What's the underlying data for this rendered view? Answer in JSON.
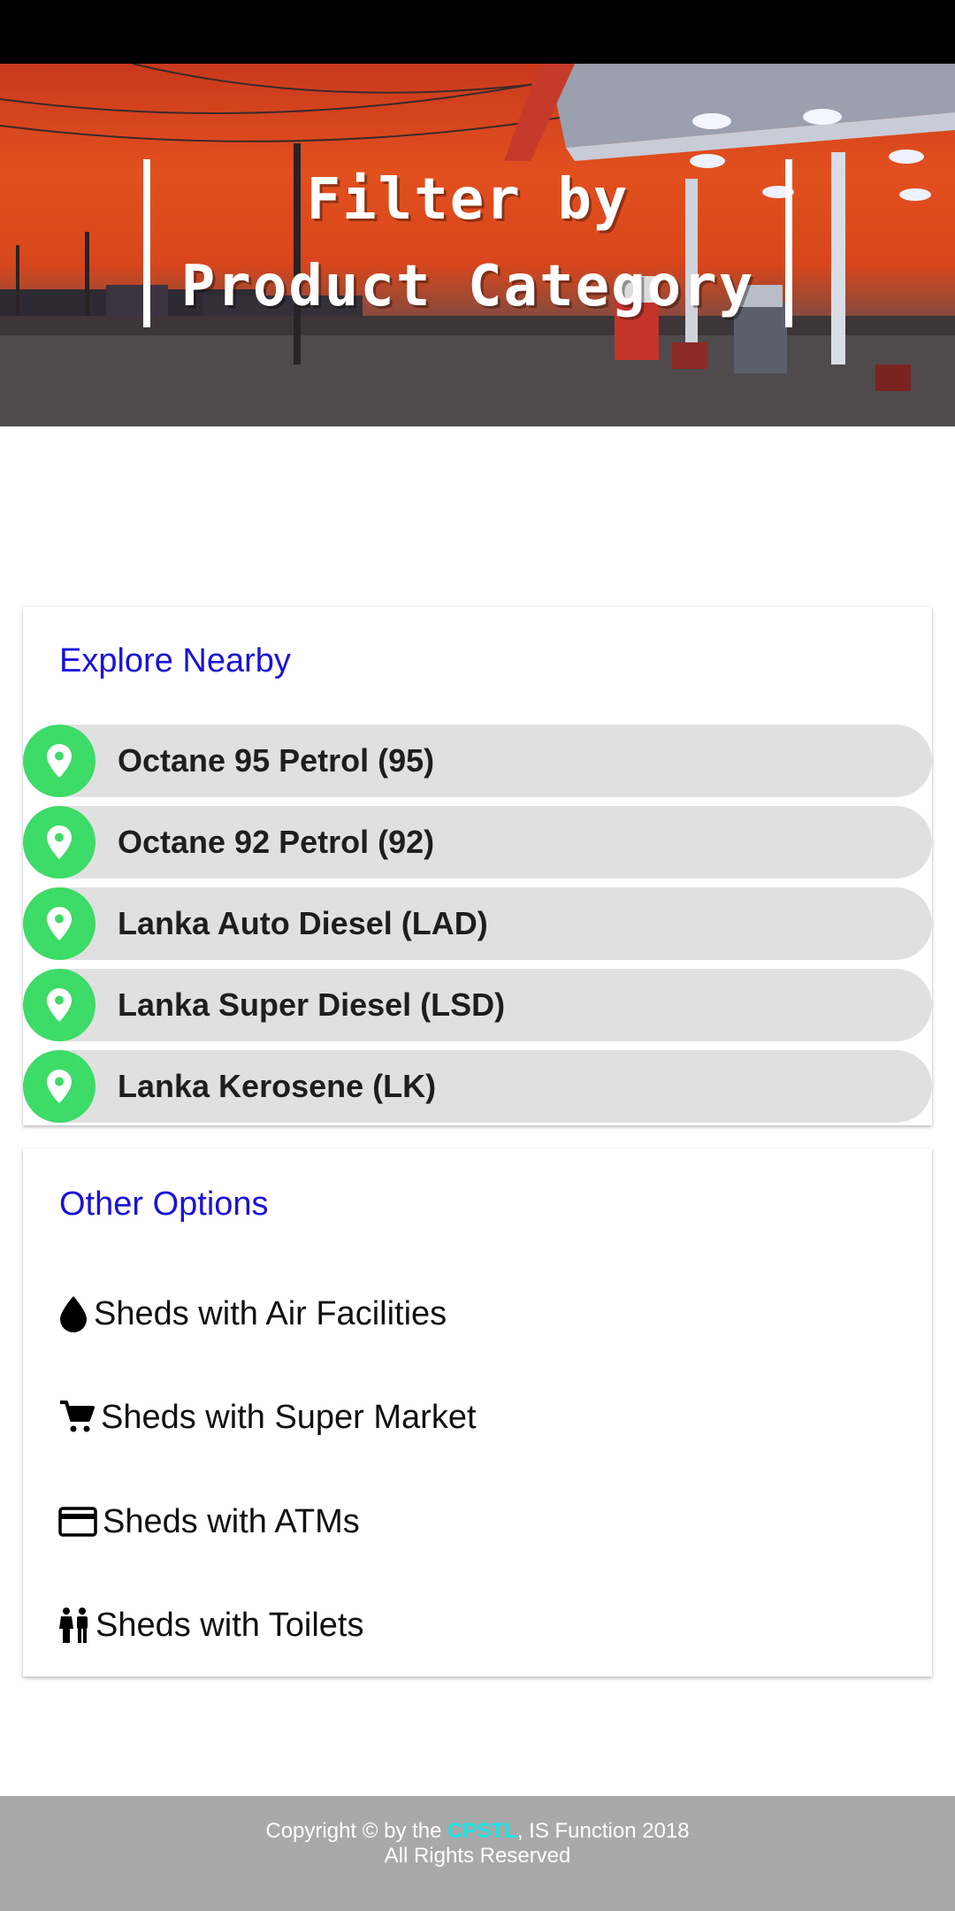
{
  "hero": {
    "title": "Filter by Product Category"
  },
  "explore": {
    "title": "Explore Nearby",
    "items": [
      {
        "label": "Octane 95 Petrol (95)",
        "icon": "map-pin-icon"
      },
      {
        "label": "Octane 92 Petrol (92)",
        "icon": "map-pin-icon"
      },
      {
        "label": "Lanka Auto Diesel (LAD)",
        "icon": "map-pin-icon"
      },
      {
        "label": "Lanka Super Diesel (LSD)",
        "icon": "map-pin-icon"
      },
      {
        "label": "Lanka Kerosene (LK)",
        "icon": "map-pin-icon"
      }
    ]
  },
  "other": {
    "title": "Other Options",
    "items": [
      {
        "label": "Sheds with Air Facilities",
        "icon": "drop-icon"
      },
      {
        "label": "Sheds with Super Market",
        "icon": "shopping-cart-icon"
      },
      {
        "label": "Sheds with ATMs",
        "icon": "credit-card-icon"
      },
      {
        "label": "Sheds with Toilets",
        "icon": "restroom-icon"
      }
    ]
  },
  "footer": {
    "copyright_prefix": "Copyright © by the ",
    "brand": "CPSTL",
    "copyright_suffix": ", IS Function 2018",
    "rights": "All Rights Reserved"
  },
  "colors": {
    "accent_title": "#1a12d9",
    "pin_green": "#3ddb67",
    "row_gray": "#e0e0e0",
    "footer_gray": "#a9a9a9",
    "brand_cyan": "#19e6e6"
  }
}
